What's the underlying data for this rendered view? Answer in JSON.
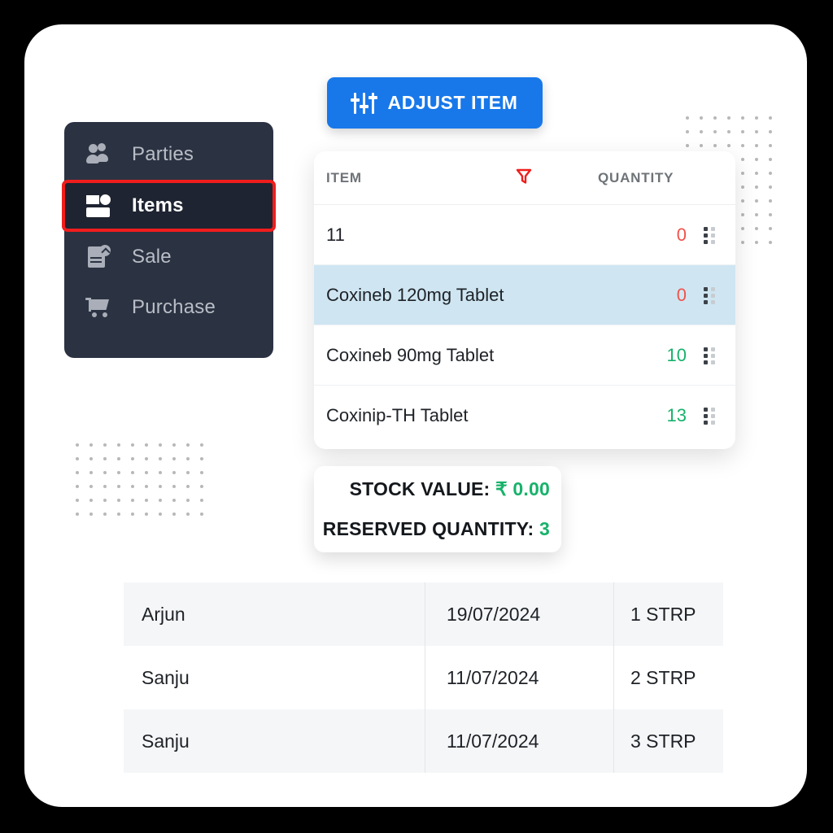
{
  "sidebar": {
    "items": [
      {
        "label": "Parties",
        "icon": "people-icon",
        "active": false
      },
      {
        "label": "Items",
        "icon": "items-icon",
        "active": true
      },
      {
        "label": "Sale",
        "icon": "sale-document-icon",
        "active": false
      },
      {
        "label": "Purchase",
        "icon": "shopping-cart-icon",
        "active": false
      }
    ]
  },
  "toolbar": {
    "adjust_item_label": "ADJUST ITEM",
    "adjust_item_icon": "sliders-icon",
    "accent_color": "#1878ea"
  },
  "items_table": {
    "columns": {
      "item": "ITEM",
      "quantity": "QUANTITY",
      "filter_icon": "filter-funnel-icon",
      "filter_color": "#f01d1d"
    },
    "rows": [
      {
        "name": "11",
        "quantity": "0",
        "qty_state": "neg",
        "selected": false,
        "handle_icon": "drag-handle-icon"
      },
      {
        "name": "Coxineb 120mg Tablet",
        "quantity": "0",
        "qty_state": "neg",
        "selected": true,
        "handle_icon": "drag-handle-icon"
      },
      {
        "name": "Coxineb 90mg Tablet",
        "quantity": "10",
        "qty_state": "pos",
        "selected": false,
        "handle_icon": "drag-handle-icon"
      },
      {
        "name": "Coxinip-TH Tablet",
        "quantity": "13",
        "qty_state": "pos",
        "selected": false,
        "handle_icon": "drag-handle-icon"
      }
    ],
    "selected_row_color": "#cfe6f2",
    "negative_color": "#f2524a",
    "positive_color": "#16b26b"
  },
  "stock_summary": {
    "stock_value_label": "STOCK VALUE:",
    "stock_value": "₹ 0.00",
    "reserved_quantity_label": "RESERVED QUANTITY:",
    "reserved_quantity": "3",
    "value_color": "#17b26a"
  },
  "transactions": {
    "rows": [
      {
        "name": "Arjun",
        "date": "19/07/2024",
        "quantity": "1 STRP"
      },
      {
        "name": "Sanju",
        "date": "11/07/2024",
        "quantity": "2 STRP"
      },
      {
        "name": "Sanju",
        "date": "11/07/2024",
        "quantity": "3 STRP"
      }
    ]
  },
  "decor": {
    "dot_color": "#b8b8b8",
    "background_color": "#000000",
    "card_color": "#ffffff"
  }
}
